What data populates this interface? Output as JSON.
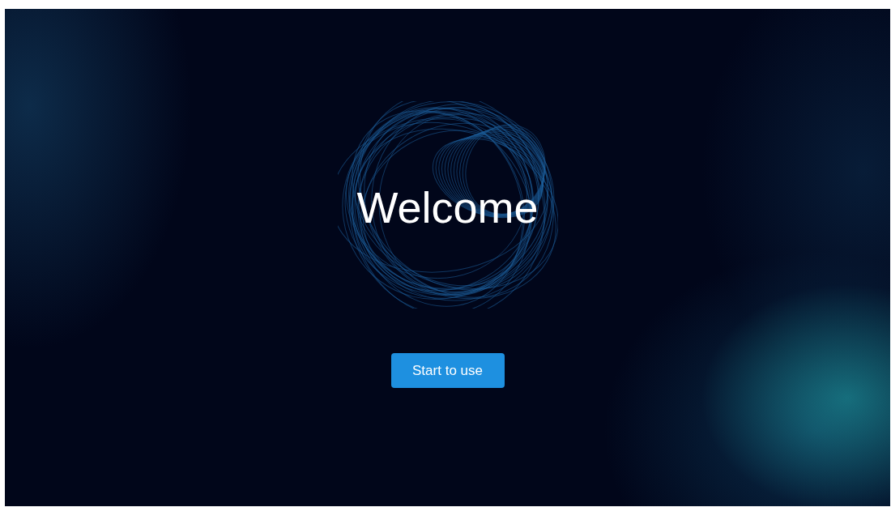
{
  "title": "Welcome",
  "button": {
    "label": "Start to use"
  }
}
